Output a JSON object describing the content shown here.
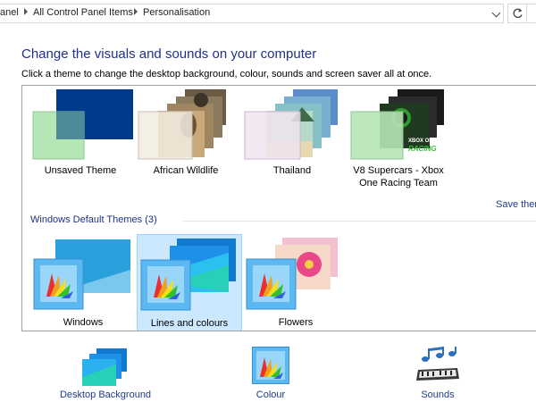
{
  "address_bar": {
    "crumbs": [
      "anel",
      "All Control Panel Items",
      "Personalisation"
    ]
  },
  "page": {
    "title": "Change the visuals and sounds on your computer",
    "subtitle": "Click a theme to change the desktop background, colour, sounds and screen saver all at once."
  },
  "my_themes": [
    {
      "label": "Unsaved Theme"
    },
    {
      "label": "African Wildlife"
    },
    {
      "label": "Thailand"
    },
    {
      "label_line1": "V8 Supercars - Xbox",
      "label_line2": "One Racing Team",
      "badge_line1": "XBOX ONE",
      "badge_line2": "RACING"
    }
  ],
  "save_link": "Save them",
  "default_group": {
    "heading": "Windows Default Themes (3)",
    "themes": [
      {
        "label": "Windows"
      },
      {
        "label": "Lines and colours",
        "selected": true
      },
      {
        "label": "Flowers"
      }
    ]
  },
  "bottom_links": [
    {
      "label": "Desktop Background",
      "icon": "desktop-background-icon"
    },
    {
      "label": "Colour",
      "icon": "colour-icon"
    },
    {
      "label": "Sounds",
      "icon": "sounds-icon"
    }
  ],
  "colors": {
    "title_blue": "#1e3287",
    "link_blue": "#1e3a8a",
    "selection_fill": "#cce8ff",
    "selection_border": "#99d1ff",
    "unsaved_blue": "#003a8c",
    "unsaved_green": "#b5e6b5"
  }
}
